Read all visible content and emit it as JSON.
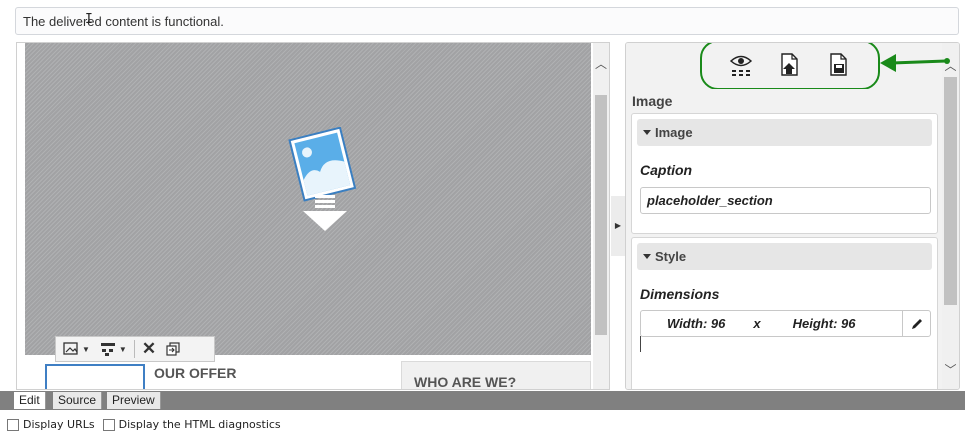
{
  "message": {
    "text": "The delivered content is functional."
  },
  "editor": {
    "offer_title": "OUR OFFER",
    "who_title": "WHO ARE WE?"
  },
  "panel": {
    "icons": [
      "preview-icon",
      "upload-document-icon",
      "save-document-icon"
    ],
    "heading": "Image",
    "image_section": {
      "title": "Image",
      "caption_label": "Caption",
      "caption_value": "placeholder_section"
    },
    "style_section": {
      "title": "Style",
      "dimensions_label": "Dimensions",
      "width": "Width: 96",
      "separator": "x",
      "height": "Height: 96"
    }
  },
  "tabs": [
    {
      "label": "Edit",
      "active": true
    },
    {
      "label": "Source",
      "active": false
    },
    {
      "label": "Preview",
      "active": false
    }
  ],
  "options": {
    "display_urls": "Display URLs",
    "display_html_diagnostics": "Display the HTML diagnostics"
  },
  "colors": {
    "annotation_green": "#1a8a1a",
    "selection_blue": "#3f7fc4",
    "canvas_gray": "#a8a9ab"
  }
}
